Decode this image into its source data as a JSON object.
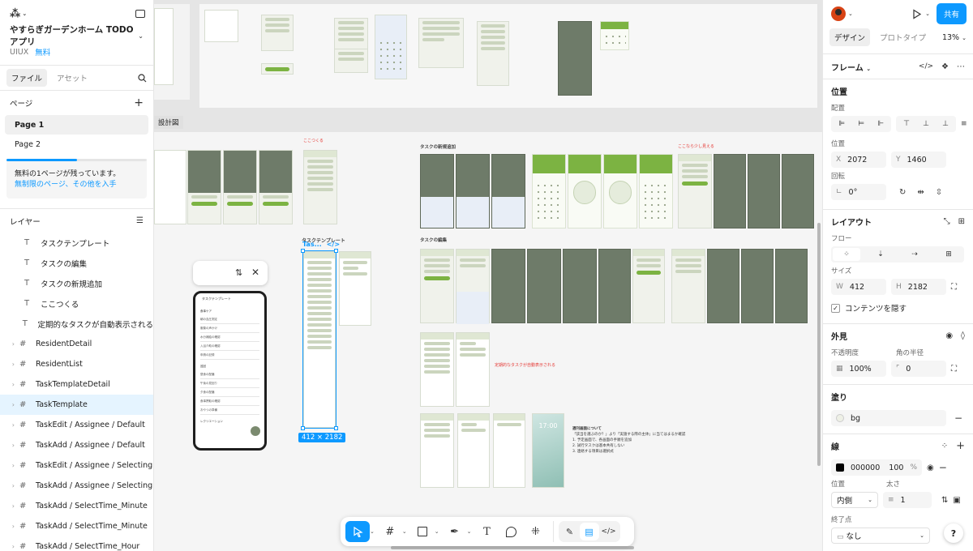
{
  "left_panel": {
    "project_title": "やすらぎガーデンホーム TODOアプリ",
    "team": "UIUX",
    "plan": "無料",
    "tabs": [
      "ファイル",
      "アセット"
    ],
    "pages_heading": "ページ",
    "pages": [
      "Page 1",
      "Page 2"
    ],
    "upsell_text": "無料の1ページが残っています。",
    "upsell_link": "無制限のページ、その他を入手",
    "pages_usage_fraction": 0.5,
    "layers_heading": "レイヤー",
    "layers": [
      {
        "type": "text",
        "label": "タスクテンプレート"
      },
      {
        "type": "text",
        "label": "タスクの編集"
      },
      {
        "type": "text",
        "label": "タスクの新規追加"
      },
      {
        "type": "text",
        "label": "ここつくる"
      },
      {
        "type": "text",
        "label": "定期的なタスクが自動表示される"
      },
      {
        "type": "frame",
        "label": "ResidentDetail"
      },
      {
        "type": "frame",
        "label": "ResidentList"
      },
      {
        "type": "frame",
        "label": "TaskTemplateDetail"
      },
      {
        "type": "frame",
        "label": "TaskTemplate",
        "selected": true
      },
      {
        "type": "frame",
        "label": "TaskEdit / Assignee / Default"
      },
      {
        "type": "frame",
        "label": "TaskAdd / Assignee / Default"
      },
      {
        "type": "frame",
        "label": "TaskEdit / Assignee / Selecting"
      },
      {
        "type": "frame",
        "label": "TaskAdd / Assignee / Selecting"
      },
      {
        "type": "frame",
        "label": "TaskAdd / SelectTime_Minute"
      },
      {
        "type": "frame",
        "label": "TaskAdd / SelectTime_Minute"
      },
      {
        "type": "frame",
        "label": "TaskAdd / SelectTime_Hour"
      }
    ]
  },
  "canvas": {
    "section_label": "設計図",
    "label_here": "ここつくる",
    "label_task_new": "タスクの新規追加",
    "label_task_edit": "タスクの編集",
    "label_notice_red": "ここなら少し見える",
    "label_template": "タスクテンプレート",
    "selected_frame_name": "Tas...",
    "selection_dims": "412 × 2182",
    "auto_task_label": "定期的なタスクが自動表示される",
    "phone_header": "タスクテンプレート",
    "phone_rows": [
      "朝の血圧測定",
      "服薬の声かけ",
      "水分補給の確認",
      "入浴介助の確認",
      "申請の記録",
      "昼食の配膳",
      "午後の見回り",
      "夕食の配膳",
      "食事摂取の確認",
      "おやつの準備"
    ],
    "phone_section_a": "食事ケア",
    "phone_section_b": "巡回",
    "phone_section_c": "レクリエーション",
    "memo_title": "週刊画面について",
    "memo_lines": [
      "「該当を選ぶのか？」より「実施する際の主体」に当てはまるか確認",
      "1. 予定画面で、各画面の手順を追加",
      "2. 試行タスクは基本共有しない",
      "3. 連絡する項目は選択式"
    ],
    "lock_time": "17:00"
  },
  "toolbar": {
    "icons": [
      "move-tool",
      "frame-tool",
      "shape-tool",
      "pen-tool",
      "text-tool",
      "comment-tool",
      "actions-tool",
      "draw-mode",
      "design-mode",
      "dev-mode"
    ]
  },
  "right_panel": {
    "tabs": [
      "デザイン",
      "プロトタイプ"
    ],
    "zoom": "13%",
    "share": "共有",
    "frame_label": "フレーム",
    "position_heading": "位置",
    "align_label": "配置",
    "position_label": "位置",
    "x_label": "X",
    "x_value": "2072",
    "y_label": "Y",
    "y_value": "1460",
    "rotation_label": "回転",
    "rotation_value": "0°",
    "layout_heading": "レイアウト",
    "flow_label": "フロー",
    "size_label": "サイズ",
    "w_label": "W",
    "w_value": "412",
    "h_label": "H",
    "h_value": "2182",
    "clip_label": "コンテンツを隠す",
    "appearance_heading": "外見",
    "opacity_label": "不透明度",
    "opacity_value": "100%",
    "radius_label": "角の半径",
    "radius_value": "0",
    "fill_heading": "塗り",
    "fill_value": "bg",
    "fill_color": "#eef0e6",
    "stroke_heading": "線",
    "stroke_hex": "000000",
    "stroke_opacity": "100",
    "stroke_percent": "%",
    "stroke_color": "#000000",
    "stroke_position_label": "位置",
    "stroke_width_label": "太さ",
    "stroke_position_value": "内側",
    "stroke_width_value": "1",
    "end_point_label": "終了点",
    "end_point_value": "なし"
  },
  "accent_color": "#0d99ff",
  "app_green": "#7cb342"
}
